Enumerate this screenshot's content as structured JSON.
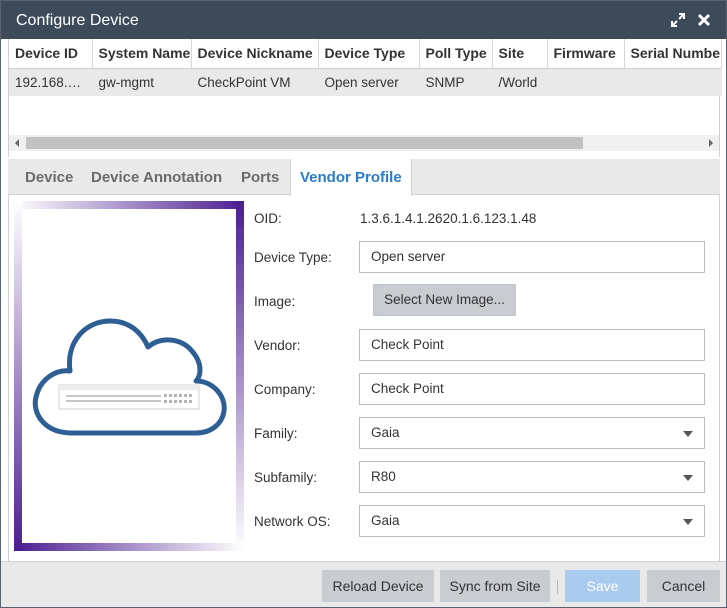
{
  "dialog": {
    "title": "Configure Device",
    "icons": {
      "maximize": "expand-arrows-icon",
      "close": "close-x-icon"
    }
  },
  "grid": {
    "columns": [
      "Device ID",
      "System Name",
      "Device Nickname",
      "Device Type",
      "Poll Type",
      "Site",
      "Firmware",
      "Serial Number"
    ],
    "rows": [
      [
        "192.168.…",
        "gw-mgmt",
        "CheckPoint VM",
        "Open server",
        "SNMP",
        "/World",
        "",
        ""
      ]
    ]
  },
  "tabs": [
    {
      "label": "Device",
      "active": false
    },
    {
      "label": "Device Annotation",
      "active": false
    },
    {
      "label": "Ports",
      "active": false
    },
    {
      "label": "Vendor Profile",
      "active": true
    }
  ],
  "vendor_profile": {
    "image_icon": "cloud-server-icon",
    "oid_label": "OID:",
    "oid_value": "1.3.6.1.4.1.2620.1.6.123.1.48",
    "device_type_label": "Device Type:",
    "device_type_value": "Open server",
    "image_label": "Image:",
    "select_image_button": "Select New Image...",
    "vendor_label": "Vendor:",
    "vendor_value": "Check Point",
    "company_label": "Company:",
    "company_value": "Check Point",
    "family_label": "Family:",
    "family_value": "Gaia",
    "subfamily_label": "Subfamily:",
    "subfamily_value": "R80",
    "network_os_label": "Network OS:",
    "network_os_value": "Gaia"
  },
  "footer": {
    "reload_label": "Reload Device",
    "sync_label": "Sync from Site",
    "save_label": "Save",
    "cancel_label": "Cancel"
  },
  "colors": {
    "titlebar": "#3c4a59",
    "accent": "#2a7bc8",
    "frame_purple": "#4b1d91",
    "cloud_blue": "#2e5f94",
    "save_disabled": "#a9cbee"
  }
}
